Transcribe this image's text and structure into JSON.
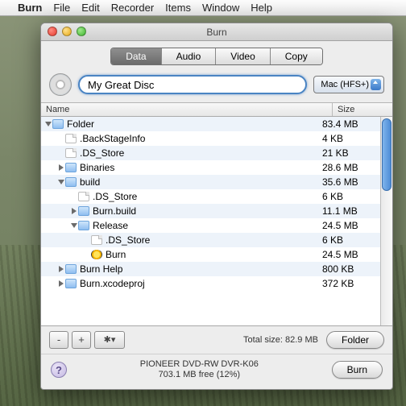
{
  "menubar": {
    "app": "Burn",
    "items": [
      "File",
      "Edit",
      "Recorder",
      "Items",
      "Window",
      "Help"
    ]
  },
  "window": {
    "title": "Burn"
  },
  "tabs": {
    "data": "Data",
    "audio": "Audio",
    "video": "Video",
    "copy": "Copy",
    "active": "data"
  },
  "disc": {
    "name": "My Great Disc",
    "filesystem": "Mac (HFS+)"
  },
  "columns": {
    "name": "Name",
    "size": "Size"
  },
  "rows": [
    {
      "indent": 0,
      "tri": "open",
      "icon": "folder",
      "label": "Folder",
      "size": "83.4 MB"
    },
    {
      "indent": 1,
      "tri": "none",
      "icon": "file",
      "label": ".BackStageInfo",
      "size": "4 KB"
    },
    {
      "indent": 1,
      "tri": "none",
      "icon": "file",
      "label": ".DS_Store",
      "size": "21 KB"
    },
    {
      "indent": 1,
      "tri": "closed",
      "icon": "folder",
      "label": "Binaries",
      "size": "28.6 MB"
    },
    {
      "indent": 1,
      "tri": "open",
      "icon": "folder",
      "label": "build",
      "size": "35.6 MB"
    },
    {
      "indent": 2,
      "tri": "none",
      "icon": "file",
      "label": ".DS_Store",
      "size": "6 KB"
    },
    {
      "indent": 2,
      "tri": "closed",
      "icon": "folder",
      "label": "Burn.build",
      "size": "11.1 MB"
    },
    {
      "indent": 2,
      "tri": "open",
      "icon": "folder",
      "label": "Release",
      "size": "24.5 MB"
    },
    {
      "indent": 3,
      "tri": "none",
      "icon": "file",
      "label": ".DS_Store",
      "size": "6 KB"
    },
    {
      "indent": 3,
      "tri": "none",
      "icon": "burn",
      "label": "Burn",
      "size": "24.5 MB"
    },
    {
      "indent": 1,
      "tri": "closed",
      "icon": "folder",
      "label": "Burn Help",
      "size": "800 KB"
    },
    {
      "indent": 1,
      "tri": "closed",
      "icon": "folder",
      "label": "Burn.xcodeproj",
      "size": "372 KB"
    }
  ],
  "toolbar": {
    "minus": "-",
    "plus": "+",
    "gear": "✱▾"
  },
  "summary": {
    "totalLabel": "Total size:",
    "totalValue": "82.9 MB",
    "chooser": "Folder"
  },
  "drive": {
    "name": "PIONEER DVD-RW DVR-K06",
    "free": "703.1 MB free (12%)"
  },
  "burnButton": "Burn"
}
